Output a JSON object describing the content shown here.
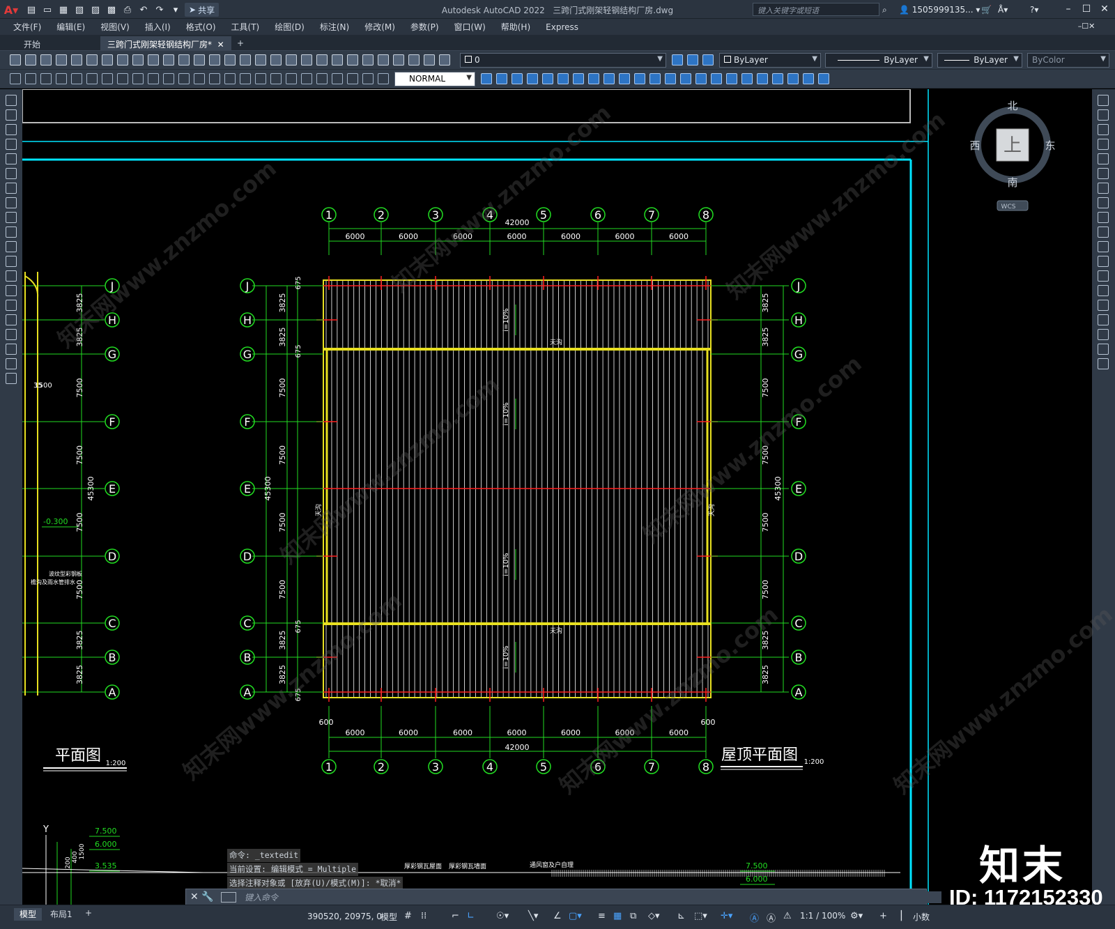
{
  "app": {
    "title": "Autodesk AutoCAD 2022",
    "filename": "三跨门式刚架轻钢结构厂房.dwg",
    "share_label": "共享"
  },
  "search": {
    "placeholder": "键入关键字或短语"
  },
  "user": {
    "name": "1505999135..."
  },
  "menu": {
    "items": [
      "文件(F)",
      "编辑(E)",
      "视图(V)",
      "插入(I)",
      "格式(O)",
      "工具(T)",
      "绘图(D)",
      "标注(N)",
      "修改(M)",
      "参数(P)",
      "窗口(W)",
      "帮助(H)",
      "Express"
    ]
  },
  "tabs": {
    "start": "开始",
    "drawing": "三跨门式刚架轻钢结构厂房*",
    "add": "+"
  },
  "toolbar": {
    "layer": "0",
    "color": "ByLayer",
    "linetype": "ByLayer",
    "lineweight": "ByLayer",
    "plotstyle": "ByColor",
    "dimstyle": "NORMAL"
  },
  "viewcube": {
    "north": "北",
    "south": "南",
    "east": "东",
    "west": "西",
    "top": "上",
    "wcs": "WCS"
  },
  "drawing": {
    "grid_numbers": [
      "1",
      "2",
      "3",
      "4",
      "5",
      "6",
      "7",
      "8"
    ],
    "grid_letters": [
      "J",
      "H",
      "G",
      "F",
      "E",
      "D",
      "C",
      "B",
      "A"
    ],
    "bay_width": "6000",
    "total_width": "42000",
    "edge_offset": "600",
    "row_dims": [
      "3825",
      "3825",
      "7500",
      "7500",
      "7500",
      "7500",
      "3825",
      "3825"
    ],
    "row_dims_small": "675",
    "total_depth": "45300",
    "slope_label": "i=10%",
    "roof_title": "屋顶平面图",
    "plan_title": "平面图",
    "scale": "1:200",
    "gutter_label": "天沟",
    "left_partial": {
      "elev": "-0.300",
      "dim_a": "1500",
      "dim_b": "35",
      "notes": [
        "波纹型彩钢板",
        "檐沟及雨水管排水"
      ]
    },
    "bottom_partial": {
      "elevs": [
        "7.500",
        "6.000",
        "3.535"
      ],
      "dims": [
        "1500",
        "400",
        "200"
      ],
      "notes": [
        "厚彩钢瓦屋面",
        "厚彩钢瓦墙面",
        "通风窗及户自理"
      ],
      "axis_y": "Y"
    },
    "bottom_right": {
      "elevs": [
        "7.500",
        "6.000"
      ]
    }
  },
  "command": {
    "history": [
      "命令: _textedit",
      "当前设置: 编辑模式 = Multiple",
      "选择注释对象或 [放弃(U)/模式(M)]: *取消*"
    ],
    "placeholder": "键入命令"
  },
  "layout_tabs": [
    "模型",
    "布局1",
    "+"
  ],
  "status": {
    "coords": "390520, 20975, 0",
    "space": "模型",
    "scale": "1:1 / 100%",
    "units": "小数"
  },
  "branding": {
    "logo": "知末",
    "id": "ID: 1172152330",
    "watermark": "知末网www.znzmo.com"
  },
  "colors": {
    "green": "#22dd22",
    "yellow": "#e8e020",
    "red": "#ff2020",
    "cyan": "#00e5ff",
    "white": "#ffffff"
  }
}
